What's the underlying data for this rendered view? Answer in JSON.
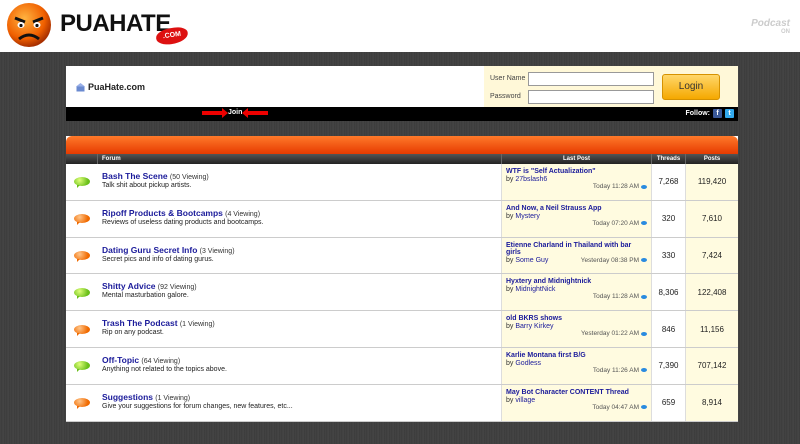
{
  "header": {
    "logo_word": "PUAHATE",
    "logo_com": ".COM",
    "podcast_badge": "Podcast",
    "podcast_small": "ON"
  },
  "loginbar": {
    "site_name": "PuaHate.com",
    "username_label": "User Name",
    "password_label": "Password",
    "username_value": "",
    "password_value": "",
    "login_label": "Login"
  },
  "blackbar": {
    "join_label": "Join",
    "follow_label": "Follow:"
  },
  "columns": {
    "forum": "Forum",
    "last_post": "Last Post",
    "threads": "Threads",
    "posts": "Posts"
  },
  "forums": [
    {
      "title": "Bash The Scene",
      "viewing": "(50 Viewing)",
      "desc": "Talk shit about pickup artists.",
      "last_title": "WTF is \"Self Actualization\"",
      "by": "by",
      "user": "27bslash6",
      "time": "Today 11:28 AM",
      "threads": "7,268",
      "posts": "119,420",
      "status": "green"
    },
    {
      "title": "Ripoff Products & Bootcamps",
      "viewing": "(4 Viewing)",
      "desc": "Reviews of useless dating products and bootcamps.",
      "last_title": "And Now, a Neil Strauss App",
      "by": "by",
      "user": "Mystery",
      "time": "Today 07:20 AM",
      "threads": "320",
      "posts": "7,610",
      "status": "orange"
    },
    {
      "title": "Dating Guru Secret Info",
      "viewing": "(3 Viewing)",
      "desc": "Secret pics and info of dating gurus.",
      "last_title": "Etienne Charland in Thailand with bar girls",
      "by": "by",
      "user": "Some Guy",
      "time": "Yesterday 08:38 PM",
      "threads": "330",
      "posts": "7,424",
      "status": "orange"
    },
    {
      "title": "Shitty Advice",
      "viewing": "(92 Viewing)",
      "desc": "Mental masturbation galore.",
      "last_title": "Hyxtery and Midnightnick",
      "by": "by",
      "user": "MidnightNick",
      "time": "Today 11:28 AM",
      "threads": "8,306",
      "posts": "122,408",
      "status": "green"
    },
    {
      "title": "Trash The Podcast",
      "viewing": "(1 Viewing)",
      "desc": "Rip on any podcast.",
      "last_title": "old BKRS shows",
      "by": "by",
      "user": "Barry Kirkey",
      "time": "Yesterday 01:22 AM",
      "threads": "846",
      "posts": "11,156",
      "status": "orange"
    },
    {
      "title": "Off-Topic",
      "viewing": "(64 Viewing)",
      "desc": "Anything not related to the topics above.",
      "last_title": "Karlie Montana first B/G",
      "by": "by",
      "user": "Godless",
      "time": "Today 11:26 AM",
      "threads": "7,390",
      "posts": "707,142",
      "status": "green"
    },
    {
      "title": "Suggestions",
      "viewing": "(1 Viewing)",
      "desc": "Give your suggestions for forum changes, new features, etc...",
      "last_title": "May Bot Character CONTENT Thread",
      "by": "by",
      "user": "village",
      "time": "Today 04:47 AM",
      "threads": "659",
      "posts": "8,914",
      "status": "orange"
    }
  ],
  "colors": {
    "accent_orange": "#e63a00",
    "link_blue": "#1a1a9a",
    "login_gold": "#f5a800"
  }
}
